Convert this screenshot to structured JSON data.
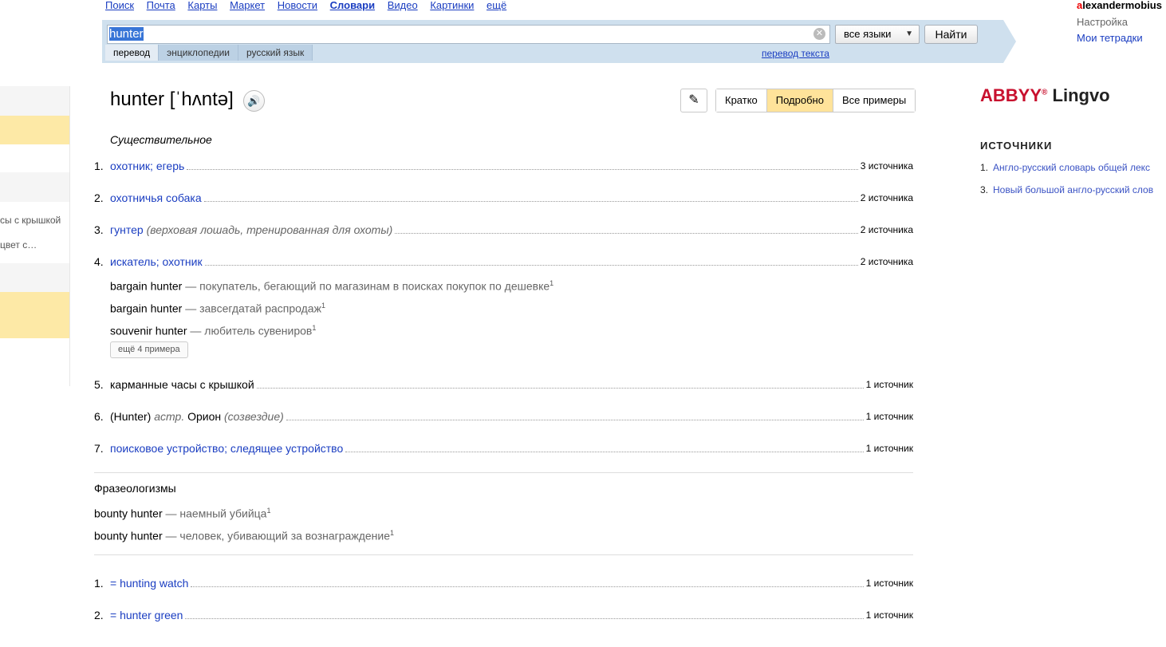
{
  "topnav": {
    "items": [
      "Поиск",
      "Почта",
      "Карты",
      "Маркет",
      "Новости",
      "Словари",
      "Видео",
      "Картинки",
      "ещё"
    ],
    "active": "Словари"
  },
  "user": {
    "first_letter": "a",
    "rest": "lexandermobius",
    "settings": "Настройка",
    "notebooks": "Мои тетрадки"
  },
  "search": {
    "query": "hunter",
    "lang_select": "все языки",
    "find_button": "Найти",
    "tabs": [
      "перевод",
      "энциклопедии",
      "русский язык"
    ],
    "active_tab": "перевод",
    "translate_text_link": "перевод текста"
  },
  "left_sidebar": {
    "items": [
      "сы с крышкой",
      "цвет с…"
    ]
  },
  "entry": {
    "word": "hunter",
    "transcription": "[ˈhʌntə]",
    "modes": [
      "Кратко",
      "Подробно",
      "Все примеры"
    ],
    "active_mode": "Подробно",
    "part_of_speech": "Существительное",
    "senses": [
      {
        "num": "1.",
        "text": "охотник; егерь",
        "note": "",
        "sources": "3 источника"
      },
      {
        "num": "2.",
        "text": "охотничья собака",
        "note": "",
        "sources": "2 источника"
      },
      {
        "num": "3.",
        "text": "гунтер",
        "note": "(верховая лошадь, тренированная для охоты)",
        "sources": "2 источника"
      },
      {
        "num": "4.",
        "text": "искатель; охотник",
        "note": "",
        "sources": "2 источника"
      },
      {
        "num": "5.",
        "text": "карманные часы с крышкой",
        "note": "",
        "sources": "1 источник"
      },
      {
        "num": "6.",
        "pre": "(Hunter)",
        "label": "астр.",
        "text": "Орион",
        "note": "(созвездие)",
        "sources": "1 источник"
      },
      {
        "num": "7.",
        "text": "поисковое устройство; следящее устройство",
        "note": "",
        "sources": "1 источник"
      }
    ],
    "examples": [
      {
        "en": "bargain hunter",
        "ru": "— покупатель, бегающий по магазинам в поисках покупок по дешевке",
        "sup": "1"
      },
      {
        "en": "bargain hunter",
        "ru": "— завсегдатай распродаж",
        "sup": "1"
      },
      {
        "en": "souvenir hunter",
        "ru": "— любитель сувениров",
        "sup": "1"
      }
    ],
    "more_examples": "ещё 4 примера",
    "phraseology_title": "Фразеологизмы",
    "phrases": [
      {
        "en": "bounty hunter",
        "ru": "— наемный убийца",
        "sup": "1"
      },
      {
        "en": "bounty hunter",
        "ru": "— человек, убивающий за вознаграждение",
        "sup": "1"
      }
    ],
    "refs": [
      {
        "num": "1.",
        "text": "= hunting watch",
        "sources": "1 источник"
      },
      {
        "num": "2.",
        "text": "= hunter green",
        "sources": "1 источник"
      }
    ]
  },
  "right": {
    "brand_abbyy": "ABBYY",
    "brand_lingvo": "Lingvo",
    "sources_title": "ИСТОЧНИКИ",
    "sources": [
      {
        "num": "1.",
        "text": "Англо-русский словарь общей лекс"
      },
      {
        "num": "3.",
        "text": "Новый большой англо-русский слов"
      }
    ]
  }
}
